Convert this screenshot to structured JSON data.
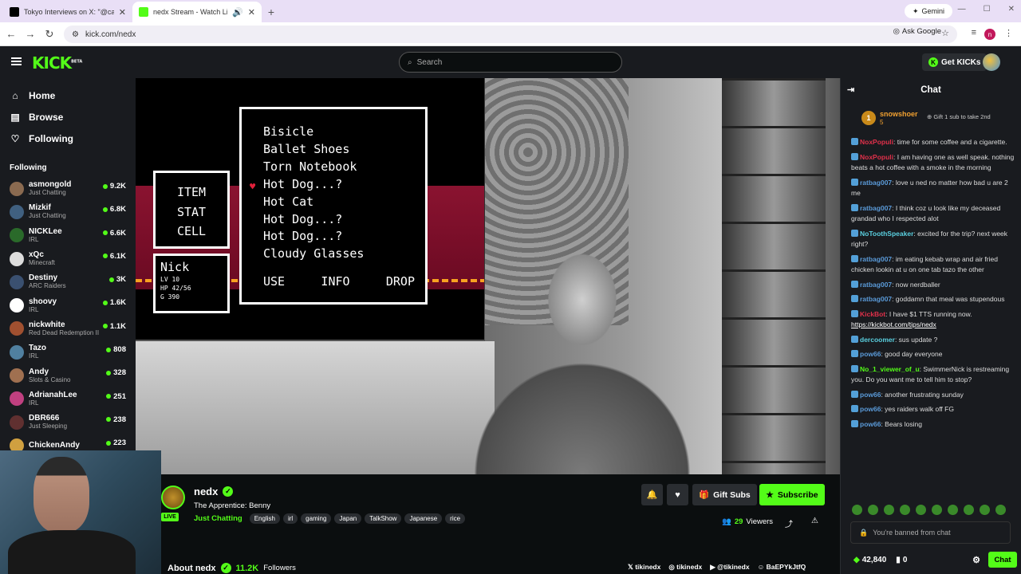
{
  "browser": {
    "tabs": [
      {
        "title": "Tokyo Interviews on X: \"@calli",
        "active": false
      },
      {
        "title": "nedx Stream - Watch Live o",
        "active": true
      }
    ],
    "gemini_label": "Gemini",
    "url": "kick.com/nedx",
    "ask_google": "Ask Google",
    "profile_initial": "n"
  },
  "header": {
    "logo": "KICK",
    "logo_sup": "BETA",
    "search_placeholder": "Search",
    "get_kicks": "Get KICKs"
  },
  "sidebar": {
    "nav": [
      {
        "label": "Home",
        "icon": "home-icon"
      },
      {
        "label": "Browse",
        "icon": "browse-icon"
      },
      {
        "label": "Following",
        "icon": "heart-icon"
      }
    ],
    "following_title": "Following",
    "channels": [
      {
        "name": "asmongold",
        "category": "Just Chatting",
        "viewers": "9.2K",
        "color": "#8a6a50"
      },
      {
        "name": "Mizkif",
        "category": "Just Chatting",
        "viewers": "6.8K",
        "color": "#406080"
      },
      {
        "name": "NICKLee",
        "category": "IRL",
        "viewers": "6.6K",
        "color": "#2a6a2a"
      },
      {
        "name": "xQc",
        "category": "Minecraft",
        "viewers": "6.1K",
        "color": "#dddddd"
      },
      {
        "name": "Destiny",
        "category": "ARC Raiders",
        "viewers": "3K",
        "color": "#3a5070"
      },
      {
        "name": "shoovy",
        "category": "IRL",
        "viewers": "1.6K",
        "color": "#ffffff"
      },
      {
        "name": "nickwhite",
        "category": "Red Dead Redemption II",
        "viewers": "1.1K",
        "color": "#a05030"
      },
      {
        "name": "Tazo",
        "category": "IRL",
        "viewers": "808",
        "color": "#5080a0"
      },
      {
        "name": "Andy",
        "category": "Slots & Casino",
        "viewers": "328",
        "color": "#a07050"
      },
      {
        "name": "AdrianahLee",
        "category": "IRL",
        "viewers": "251",
        "color": "#c04080"
      },
      {
        "name": "DBR666",
        "category": "Just Sleeping",
        "viewers": "238",
        "color": "#603030"
      },
      {
        "name": "ChickenAndy",
        "category": "",
        "viewers": "223",
        "color": "#d0a040"
      }
    ]
  },
  "game": {
    "menu": [
      "ITEM",
      "STAT",
      "CELL"
    ],
    "player": {
      "name": "Nick",
      "lv": "LV 10",
      "hp": "HP 42/56",
      "g": "G 390"
    },
    "items": [
      "Bisicle",
      "Ballet Shoes",
      "Torn Notebook",
      "Hot Dog...?",
      "Hot Cat",
      "Hot Dog...?",
      "Hot Dog...?",
      "Cloudy Glasses"
    ],
    "actions": [
      "USE",
      "INFO",
      "DROP"
    ]
  },
  "channel": {
    "name": "nedx",
    "live": "LIVE",
    "title": "The Apprentice: Benny",
    "category": "Just Chatting",
    "tags": [
      "English",
      "irl",
      "gaming",
      "Japan",
      "TalkShow",
      "Japanese",
      "rice"
    ],
    "gift_subs": "Gift Subs",
    "subscribe": "Subscribe",
    "viewers": "29",
    "viewers_label": "Viewers",
    "about": "About nedx",
    "followers": "11.2K",
    "followers_label": "Followers",
    "socials": [
      "tikinedx",
      "tikinedx",
      "@tikinedx",
      "BaEPYkJtfQ"
    ]
  },
  "chat": {
    "title": "Chat",
    "pinned": {
      "rank": "1",
      "name": "snowshoer",
      "level": "5",
      "gift_text": "Gift 1 sub to take 2nd"
    },
    "messages": [
      {
        "user": "NoxPopuli",
        "color": "#e0304a",
        "text": ": time for some coffee and a cigarette."
      },
      {
        "user": "NoxPopuli",
        "color": "#e0304a",
        "text": ": I am having one as well speak. nothing beats a hot coffee with a smoke in the morning"
      },
      {
        "user": "ratbag007",
        "color": "#5a9ad8",
        "text": ": love u ned no matter how bad u are 2 me"
      },
      {
        "user": "ratbag007",
        "color": "#5a9ad8",
        "text": ": I think coz u look like my deceased grandad who I respected alot"
      },
      {
        "user": "NoToothSpeaker",
        "color": "#5ad0e0",
        "text": ": excited for the trip? next week right?"
      },
      {
        "user": "ratbag007",
        "color": "#5a9ad8",
        "text": ": im eating kebab wrap and air fried chicken lookin at u on one tab tazo the other"
      },
      {
        "user": "ratbag007",
        "color": "#5a9ad8",
        "text": ": now nerdballer"
      },
      {
        "user": "ratbag007",
        "color": "#5a9ad8",
        "text": ": goddamn that meal was stupendous"
      },
      {
        "user": "KickBot",
        "color": "#e0304a",
        "text": ": I have $1 TTS running now.",
        "link": "https://kickbot.com/tips/nedx"
      },
      {
        "user": "dercoomer",
        "color": "#5ad0e0",
        "text": ": sus update ?"
      },
      {
        "user": "pow66",
        "color": "#5a9ad8",
        "text": ": good day everyone"
      },
      {
        "user": "No_1_viewer_of_u",
        "color": "#53fc18",
        "text": ": SwimmerNick is restreaming you. Do you want me to tell him to stop?"
      },
      {
        "user": "pow66",
        "color": "#5a9ad8",
        "text": ": another frustrating sunday"
      },
      {
        "user": "pow66",
        "color": "#5a9ad8",
        "text": ": yes raiders walk off FG"
      },
      {
        "user": "pow66",
        "color": "#5a9ad8",
        "text": ": Bears losing"
      }
    ],
    "banned_text": "You're banned from chat",
    "kicks": "42,840",
    "subs": "0",
    "chat_button": "Chat"
  }
}
